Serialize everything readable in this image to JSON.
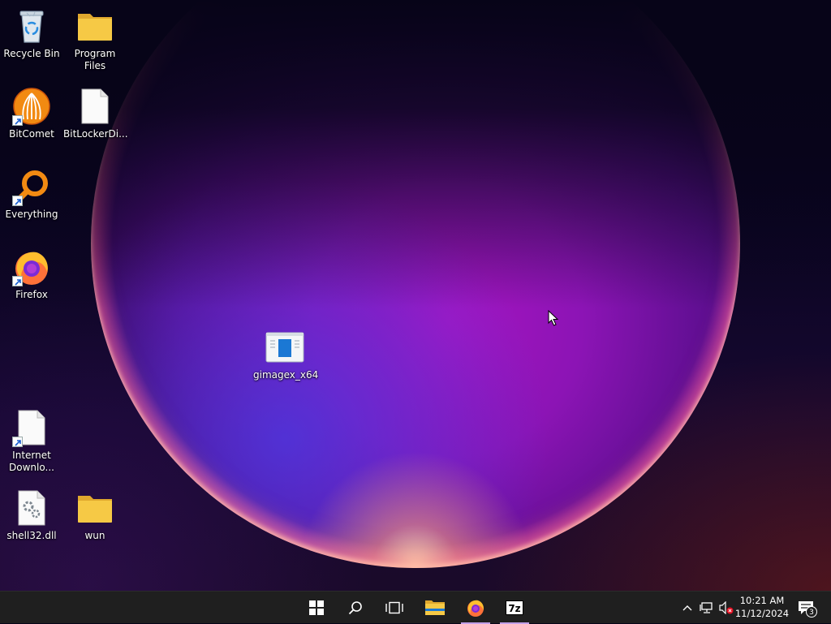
{
  "desktop": {
    "icons": [
      {
        "label": "Recycle Bin"
      },
      {
        "label": "Program Files"
      },
      {
        "label": "BitComet"
      },
      {
        "label": "BitLockerDi..."
      },
      {
        "label": "Everything"
      },
      {
        "label": "Firefox"
      },
      {
        "label": "gimagex_x64"
      },
      {
        "label": "Internet\nDownlo..."
      },
      {
        "label": "shell32.dll"
      },
      {
        "label": "wun"
      }
    ]
  },
  "taskbar": {
    "buttons": [
      "start-icon",
      "search-icon",
      "task-view-icon",
      "file-explorer-icon",
      "firefox-icon",
      "7zip-icon"
    ],
    "sevenzip_label": "7z",
    "clock": {
      "time": "10:21 AM",
      "date": "11/12/2024"
    },
    "notifications": {
      "count": "3"
    }
  },
  "colors": {
    "taskbar_bg": "#1f1f1f",
    "active_indicator": "#c2a0e8",
    "folder_yellow": "#f6c945"
  }
}
